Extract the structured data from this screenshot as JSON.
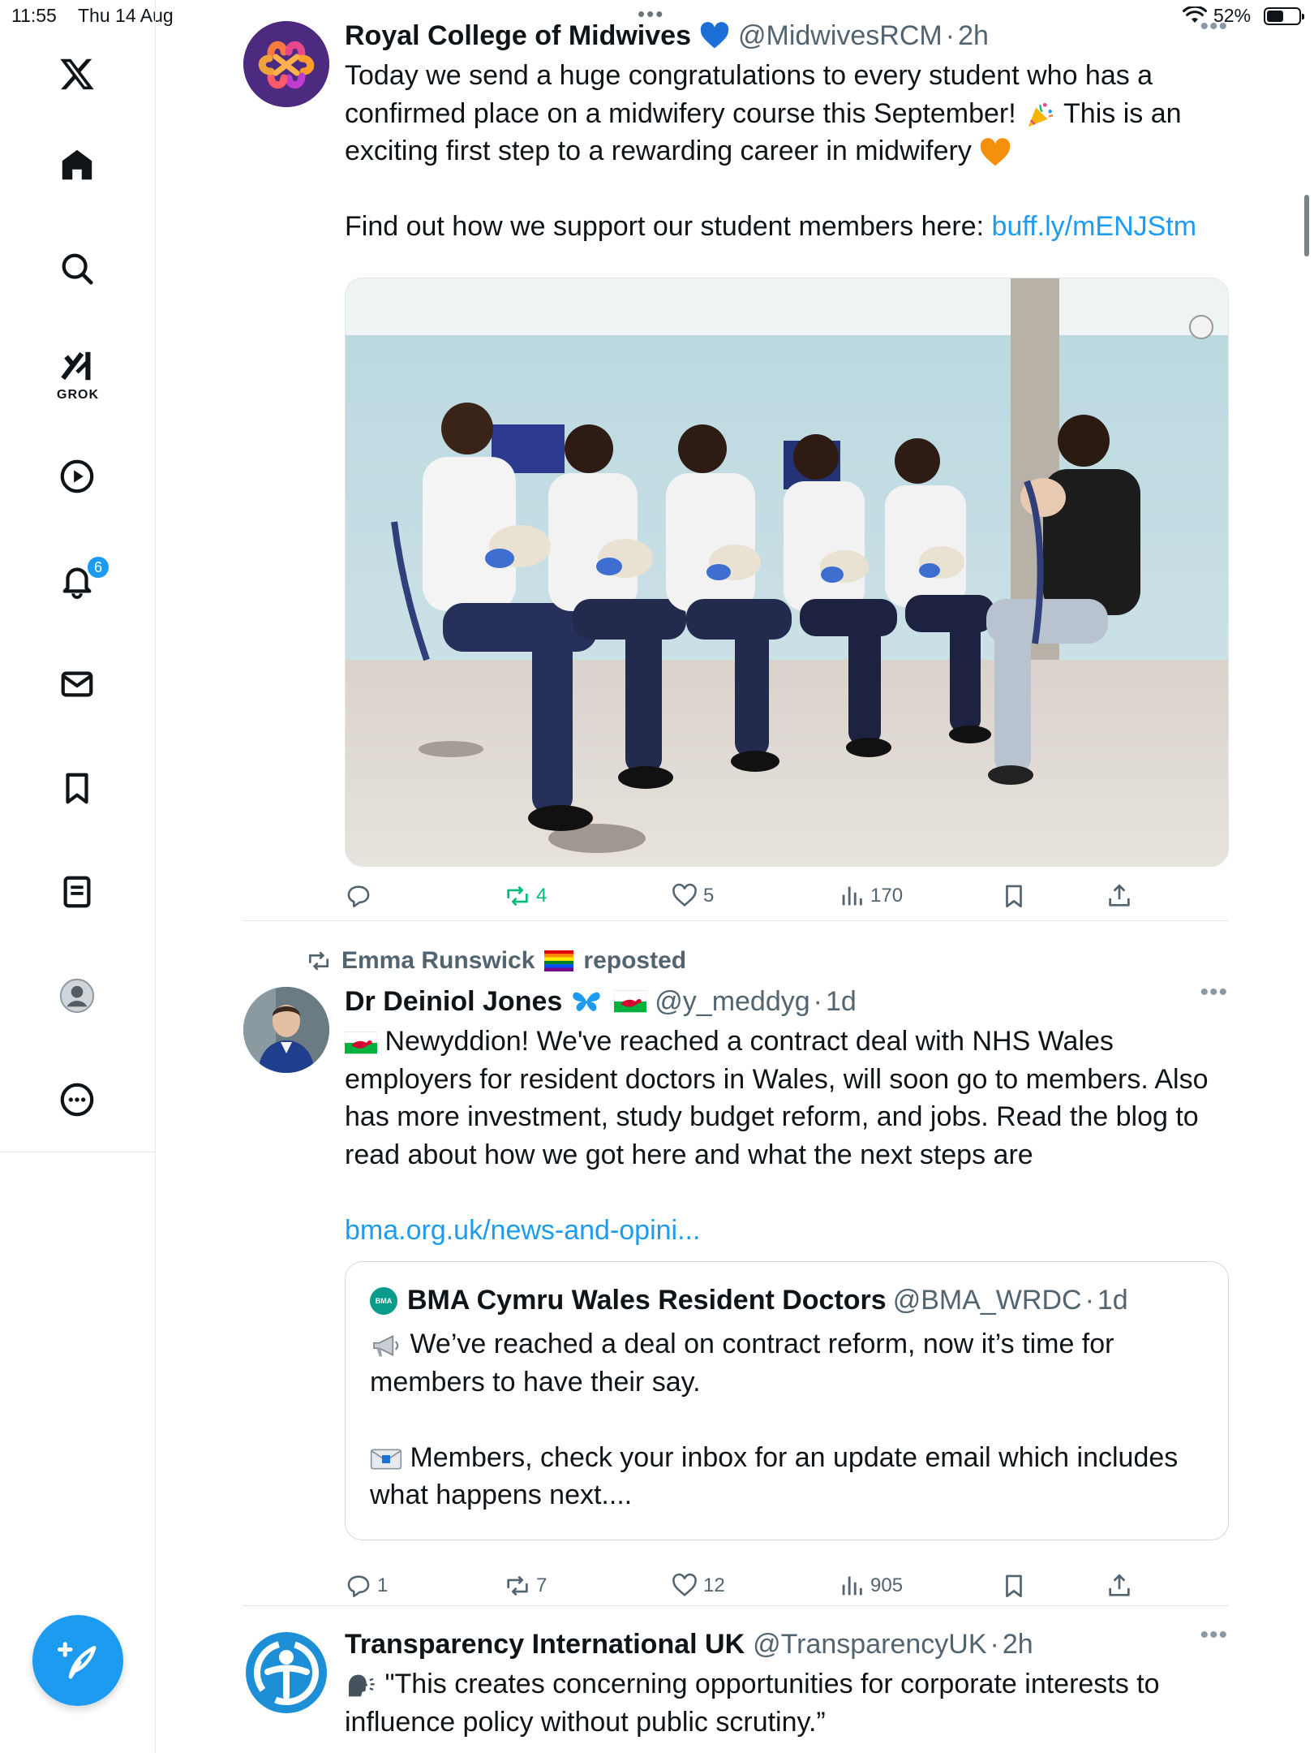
{
  "status_bar": {
    "time": "11:55",
    "date": "Thu 14 Aug",
    "battery": "52%"
  },
  "sidebar": {
    "grok_label": "GROK",
    "notifications_count": "6",
    "icons": [
      "x-logo-icon",
      "home-icon",
      "search-icon",
      "grok-icon",
      "video-icon",
      "bell-icon",
      "mail-icon",
      "bookmark-icon",
      "lists-icon",
      "profile-icon",
      "more-icon",
      "compose-icon"
    ]
  },
  "tweets": [
    {
      "name": "Royal College of Midwives",
      "handle": "@MidwivesRCM",
      "time": "2h",
      "text": "Today we send a huge congratulations to every student who has a confirmed place on a midwifery course this September!",
      "text_2": "This is an exciting first step to a rewarding career in midwifery",
      "text_3": "Find out how we support our student members here:",
      "link": "buff.ly/mENJStm",
      "actions": {
        "replies": "",
        "reposts": "4",
        "likes": "5",
        "views": "170"
      },
      "accent_repost": "#00ba7c"
    },
    {
      "reposted_by": "Emma Runswick",
      "reposted_label": "reposted",
      "name": "Dr Deiniol Jones",
      "handle": "@y_meddyg",
      "time": "1d",
      "text": "Newyddion! We've reached a contract deal with NHS Wales employers for resident doctors in Wales, will soon go to members. Also has more investment, study budget reform, and jobs. Read the blog to read about how we got here and what the next steps are",
      "link": "bma.org.uk/news-and-opini...",
      "quote": {
        "name": "BMA Cymru Wales Resident Doctors",
        "handle": "@BMA_WRDC",
        "time": "1d",
        "avatar_label": "BMA",
        "text": "We’ve reached a deal on contract reform, now it’s time for members to have their say.",
        "text_2": "Members, check your inbox for an update email which includes what happens next...."
      },
      "actions": {
        "replies": "1",
        "reposts": "7",
        "likes": "12",
        "views": "905"
      }
    },
    {
      "name": "Transparency International UK",
      "handle": "@TransparencyUK",
      "time": "2h",
      "text": "\"This creates concerning opportunities for corporate interests to influence policy without public scrutiny.”"
    }
  ],
  "colors": {
    "accent": "#1d9bf0",
    "text": "#0f1419",
    "muted": "#536471",
    "repost_active": "#00ba7c"
  }
}
